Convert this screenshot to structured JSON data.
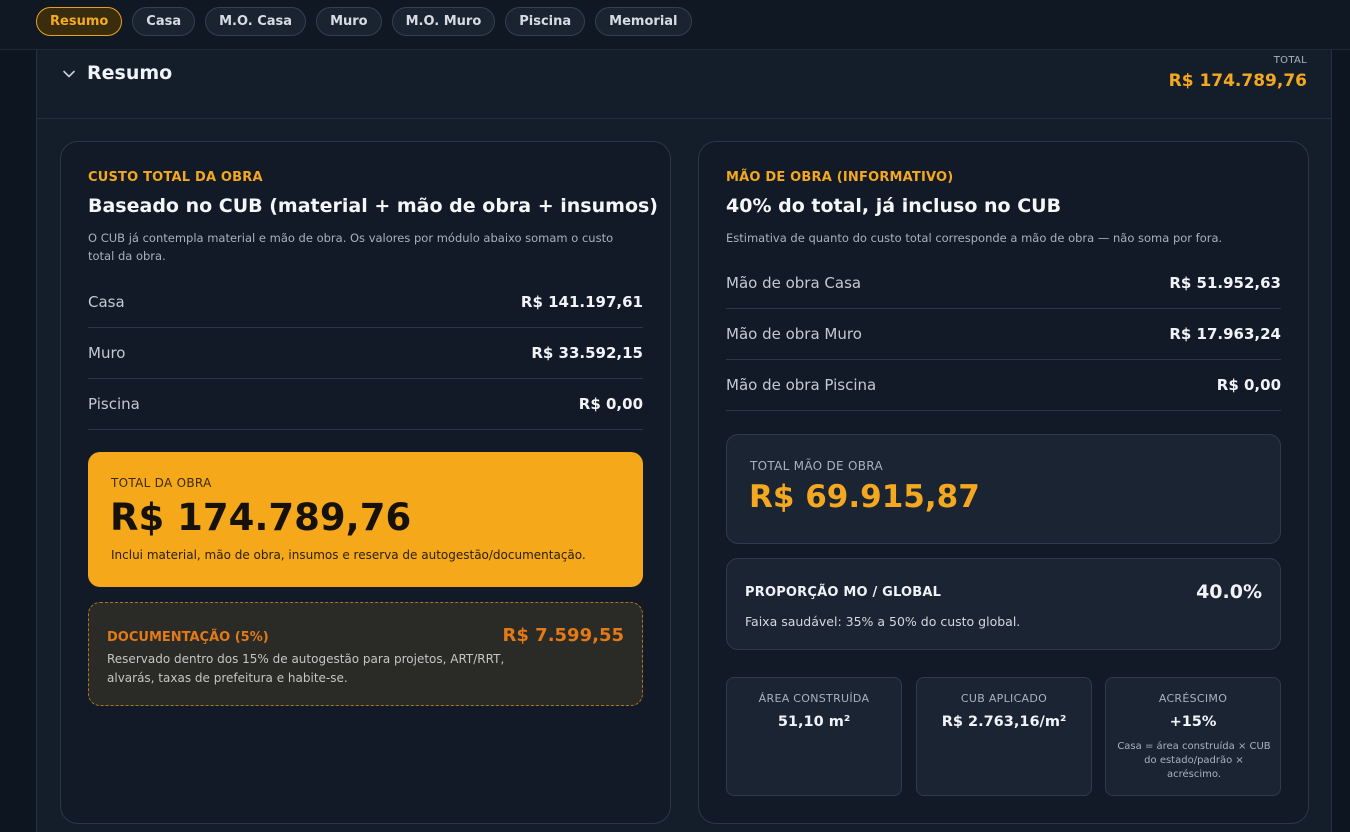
{
  "tabs": [
    {
      "label": "Resumo",
      "active": true
    },
    {
      "label": "Casa",
      "active": false
    },
    {
      "label": "M.O. Casa",
      "active": false
    },
    {
      "label": "Muro",
      "active": false
    },
    {
      "label": "M.O. Muro",
      "active": false
    },
    {
      "label": "Piscina",
      "active": false
    },
    {
      "label": "Memorial",
      "active": false
    }
  ],
  "header": {
    "title": "Resumo",
    "total_label": "TOTAL",
    "total_value": "R$ 174.789,76"
  },
  "left": {
    "eyebrow": "CUSTO TOTAL DA OBRA",
    "heading": "Baseado no CUB (material + mão de obra + insumos)",
    "description": "O CUB já contempla material e mão de obra. Os valores por módulo abaixo somam o custo total da obra.",
    "rows": [
      {
        "label": "Casa",
        "value": "R$ 141.197,61"
      },
      {
        "label": "Muro",
        "value": "R$ 33.592,15"
      },
      {
        "label": "Piscina",
        "value": "R$ 0,00"
      }
    ],
    "total": {
      "label": "TOTAL DA OBRA",
      "value": "R$ 174.789,76",
      "description": "Inclui material, mão de obra, insumos e reserva de autogestão/documentação."
    },
    "documentation": {
      "label": "DOCUMENTAÇÃO (5%)",
      "value": "R$ 7.599,55",
      "description": "Reservado dentro dos 15% de autogestão para projetos, ART/RRT, alvarás, taxas de prefeitura e habite-se."
    }
  },
  "right": {
    "eyebrow": "MÃO DE OBRA (INFORMATIVO)",
    "heading": "40% do total, já incluso no CUB",
    "description": "Estimativa de quanto do custo total corresponde a mão de obra — não soma por fora.",
    "rows": [
      {
        "label": "Mão de obra Casa",
        "value": "R$ 51.952,63"
      },
      {
        "label": "Mão de obra Muro",
        "value": "R$ 17.963,24"
      },
      {
        "label": "Mão de obra Piscina",
        "value": "R$ 0,00"
      }
    ],
    "total": {
      "label": "TOTAL MÃO DE OBRA",
      "value": "R$ 69.915,87"
    },
    "proportion": {
      "label": "PROPORÇÃO MO / GLOBAL",
      "value": "40.0%",
      "description": "Faixa saudável: 35% a 50% do custo global."
    },
    "stats": [
      {
        "label": "ÁREA CONSTRUÍDA",
        "value": "51,10 m²",
        "note": ""
      },
      {
        "label": "CUB APLICADO",
        "value": "R$ 2.763,16/m²",
        "note": ""
      },
      {
        "label": "ACRÉSCIMO",
        "value": "+15%",
        "note": "Casa = área construída × CUB do estado/padrão × acréscimo."
      }
    ]
  },
  "colors": {
    "accent": "#f4a81f",
    "background": "#0d1520",
    "card": "#111a26",
    "doc_accent": "#e37a18"
  }
}
